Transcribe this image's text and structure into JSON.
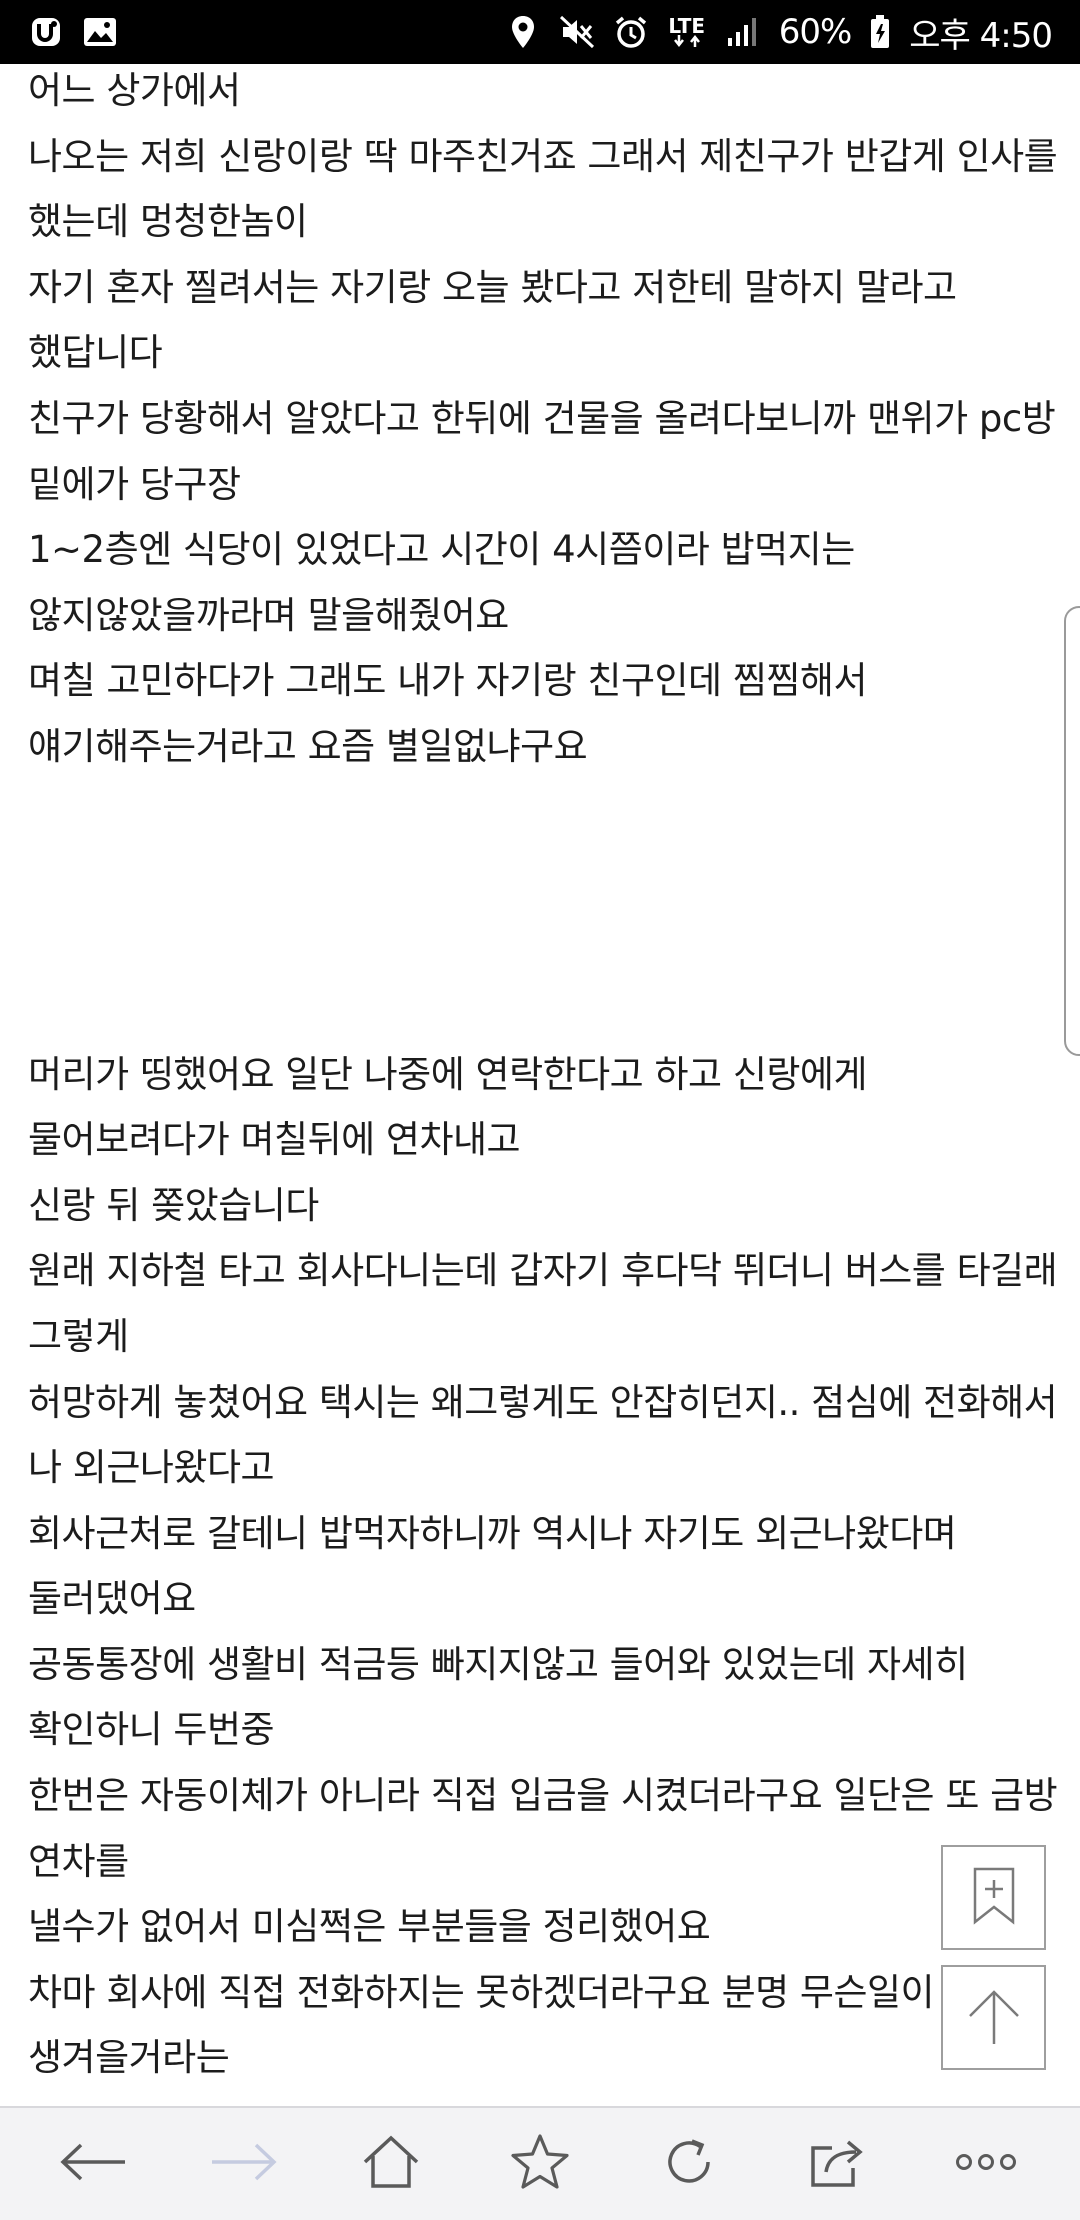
{
  "status_bar": {
    "lte_label": "LTE",
    "battery_percent": "60%",
    "time": "오후 4:50",
    "icons": [
      "carrier-app-icon",
      "gallery-icon",
      "location-icon",
      "vibrate-mute-icon",
      "alarm-icon",
      "lte-icon",
      "signal-icon",
      "battery-icon"
    ]
  },
  "article": {
    "paragraphs_top": [
      "어느 상가에서",
      "나오는 저희 신랑이랑 딱 마주친거죠 그래서 제친구가 반갑게 인사를 했는데 멍청한놈이",
      "자기 혼자 찔려서는 자기랑 오늘 봤다고 저한테 말하지 말라고 했답니다",
      "친구가 당황해서 알았다고 한뒤에 건물을 올려다보니까 맨위가 pc방 밑에가 당구장",
      "1~2층엔 식당이 있었다고 시간이 4시쯤이라 밥먹지는 않지않았을까라며 말을해줬어요",
      "며칠 고민하다가 그래도 내가 자기랑 친구인데 찜찜해서 얘기해주는거라고 요즘 별일없냐구요"
    ],
    "paragraphs_bottom": [
      "머리가 띵했어요 일단 나중에 연락한다고 하고 신랑에게 물어보려다가 며칠뒤에 연차내고",
      "신랑 뒤 쫒았습니다",
      "원래 지하철 타고 회사다니는데 갑자기 후다닥 뛰더니 버스를 타길래 그렇게",
      "허망하게 놓쳤어요 택시는 왜그렇게도 안잡히던지.. 점심에 전화해서 나 외근나왔다고",
      "회사근처로 갈테니 밥먹자하니까 역시나 자기도 외근나왔다며 둘러댔어요",
      "공동통장에 생활비 적금등 빠지지않고 들어와 있었는데 자세히 확인하니 두번중",
      "한번은 자동이체가 아니라 직접 입금을 시켰더라구요 일단은 또 금방 연차를",
      "낼수가 없어서 미심쩍은 부분들을 정리했어요",
      "차마 회사에 직접 전화하지는 못하겠더라구요 분명 무슨일이 생겨을거라는"
    ]
  },
  "floating_buttons": {
    "bookmark_icon": "bookmark-add-icon",
    "top_icon": "scroll-top-icon"
  },
  "toolbar": {
    "items": [
      "back-icon",
      "forward-icon",
      "home-icon",
      "bookmarks-icon",
      "refresh-icon",
      "share-icon",
      "more-icon"
    ],
    "disabled_color": "#c5cbe0",
    "icon_color": "#5a5a5a"
  }
}
